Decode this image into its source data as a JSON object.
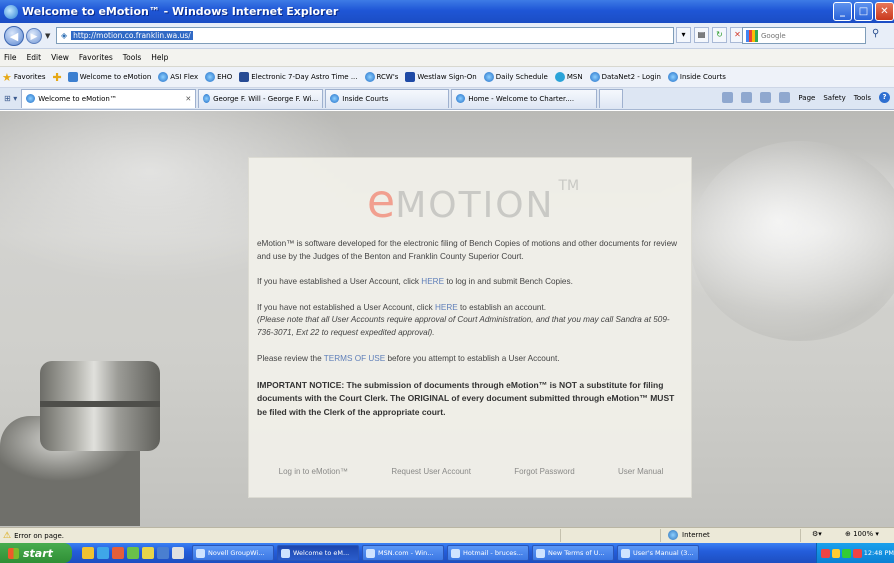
{
  "window": {
    "title": "Welcome to eMotion™ - Windows Internet Explorer",
    "controls": [
      "_",
      "□",
      "✕"
    ]
  },
  "address": {
    "url": "http://motion.co.franklin.wa.us/",
    "search_placeholder": "Google"
  },
  "menu": [
    "File",
    "Edit",
    "View",
    "Favorites",
    "Tools",
    "Help"
  ],
  "favorites": {
    "label": "Favorites",
    "items": [
      {
        "label": "Welcome to eMotion",
        "icon": "emotion-icon"
      },
      {
        "label": "ASI Flex",
        "icon": "ie-icon"
      },
      {
        "label": "EHO",
        "icon": "ie-icon"
      },
      {
        "label": "Electronic 7-Day Astro Time ...",
        "icon": "x-icon"
      },
      {
        "label": "RCW's",
        "icon": "ie-icon"
      },
      {
        "label": "Westlaw Sign-On",
        "icon": "w-icon"
      },
      {
        "label": "Daily Schedule",
        "icon": "ie-icon"
      },
      {
        "label": "MSN",
        "icon": "msn-icon"
      },
      {
        "label": "DataNet2 - Login",
        "icon": "ie-icon"
      },
      {
        "label": "Inside Courts",
        "icon": "ie-icon"
      }
    ]
  },
  "tabs": [
    {
      "label": "Welcome to eMotion™",
      "active": true
    },
    {
      "label": "George F. Will - George F. Wi...",
      "active": false
    },
    {
      "label": "Inside Courts",
      "active": false
    },
    {
      "label": "Home - Welcome to Charter....",
      "active": false
    }
  ],
  "command_bar": {
    "page": "Page",
    "safety": "Safety",
    "tools": "Tools"
  },
  "panel": {
    "logo_e": "e",
    "logo_rest": "MOTION",
    "logo_tm": "TM",
    "intro": "eMotion™ is software developed for the electronic filing of Bench Copies of motions and other documents for review and use by the Judges of the Benton and Franklin County Superior Court.",
    "login_pre": "If you have established a User Account, click ",
    "login_link": "HERE",
    "login_post": " to log in and submit Bench Copies.",
    "register_pre": "If you have not established a User Account, click ",
    "register_link": "HERE",
    "register_post": " to establish an account.",
    "register_note": "(Please note that all User Accounts require approval of Court Administration, and that you may call Sandra at 509-736-3071, Ext 22 to request expedited approval).",
    "terms_pre": "Please review the ",
    "terms_link": "TERMS OF USE",
    "terms_post": " before you attempt to establish a User Account.",
    "important": "IMPORTANT NOTICE: The submission of documents through eMotion™ is NOT a substitute for filing documents with the Court Clerk. The ORIGINAL of every document submitted through eMotion™ MUST be filed with the Clerk of the appropriate court.",
    "links": [
      "Log in to eMotion™",
      "Request User Account",
      "Forgot Password",
      "User Manual"
    ]
  },
  "status": {
    "text": "Error on page.",
    "zone": "Internet",
    "zoom": "100%"
  },
  "taskbar": {
    "start": "start",
    "items": [
      "Novell GroupWi...",
      "Welcome to eM...",
      "MSN.com - Win...",
      "Hotmail - bruces...",
      "New Terms of U...",
      "User's Manual (3..."
    ],
    "clock": "12:48 PM"
  },
  "colors": {
    "titlebar": "#1f56d6",
    "logo_e": "#f19f8f",
    "link": "#5f7fb9",
    "panel_bg": "#f0efe9"
  }
}
